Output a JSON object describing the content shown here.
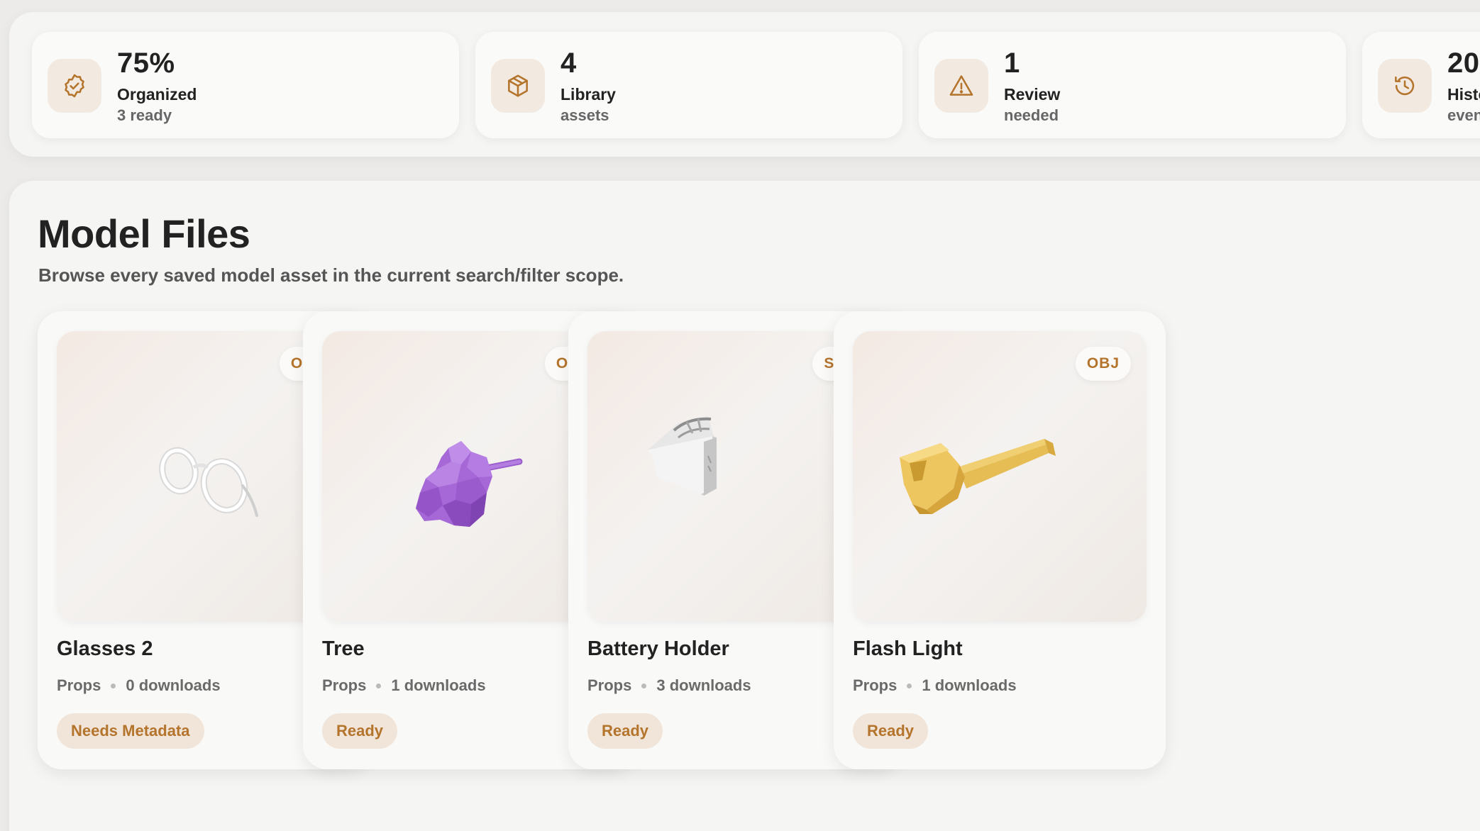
{
  "stats": [
    {
      "value": "75%",
      "label": "Organized",
      "sub": "3 ready",
      "icon": "badge-check-icon"
    },
    {
      "value": "4",
      "label": "Library",
      "sub": "assets",
      "icon": "box-icon"
    },
    {
      "value": "1",
      "label": "Review",
      "sub": "needed",
      "icon": "warning-icon"
    },
    {
      "value": "20",
      "label": "History",
      "sub": "events",
      "icon": "history-icon"
    }
  ],
  "section": {
    "title": "Model Files",
    "subtitle": "Browse every saved model asset in the current search/filter scope."
  },
  "models": [
    {
      "name": "Glasses 2",
      "format": "OBJ",
      "category": "Props",
      "downloads": "0 downloads",
      "status": "Needs Metadata",
      "icon": "glasses-model-icon",
      "color": "#ffffff"
    },
    {
      "name": "Tree",
      "format": "OBJ",
      "category": "Props",
      "downloads": "1 downloads",
      "status": "Ready",
      "icon": "tree-model-icon",
      "color": "#a66bd8"
    },
    {
      "name": "Battery Holder",
      "format": "STL",
      "category": "Props",
      "downloads": "3 downloads",
      "status": "Ready",
      "icon": "battery-holder-model-icon",
      "color": "#f2f2f2"
    },
    {
      "name": "Flash Light",
      "format": "OBJ",
      "category": "Props",
      "downloads": "1 downloads",
      "status": "Ready",
      "icon": "flashlight-model-icon",
      "color": "#e8c25a"
    }
  ],
  "colors": {
    "accent": "#b4742c",
    "accent_bg": "#f1e5da"
  }
}
